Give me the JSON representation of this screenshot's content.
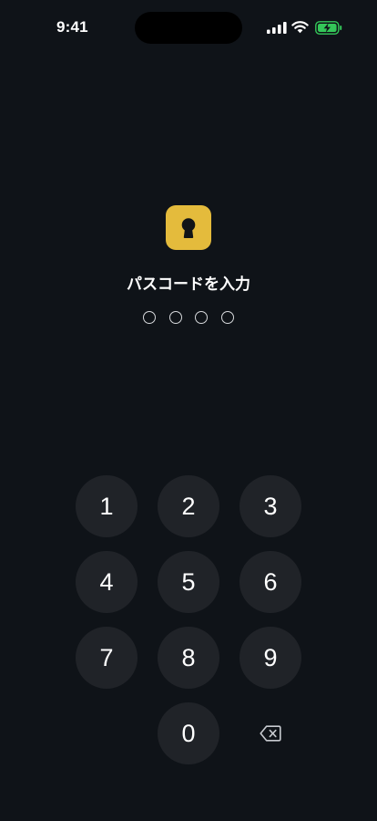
{
  "status_bar": {
    "time": "9:41",
    "icons": [
      "cellular-signal-icon",
      "wifi-icon",
      "battery-charging-icon"
    ],
    "battery_color": "#34c759"
  },
  "lock_screen": {
    "icon": "keyhole-icon",
    "accent_color": "#e4bb3c",
    "title": "パスコードを入力",
    "passcode_length": 4,
    "entered_digits": 0
  },
  "keypad": {
    "keys": [
      "1",
      "2",
      "3",
      "4",
      "5",
      "6",
      "7",
      "8",
      "9",
      "0"
    ],
    "delete_icon": "backspace-icon"
  }
}
